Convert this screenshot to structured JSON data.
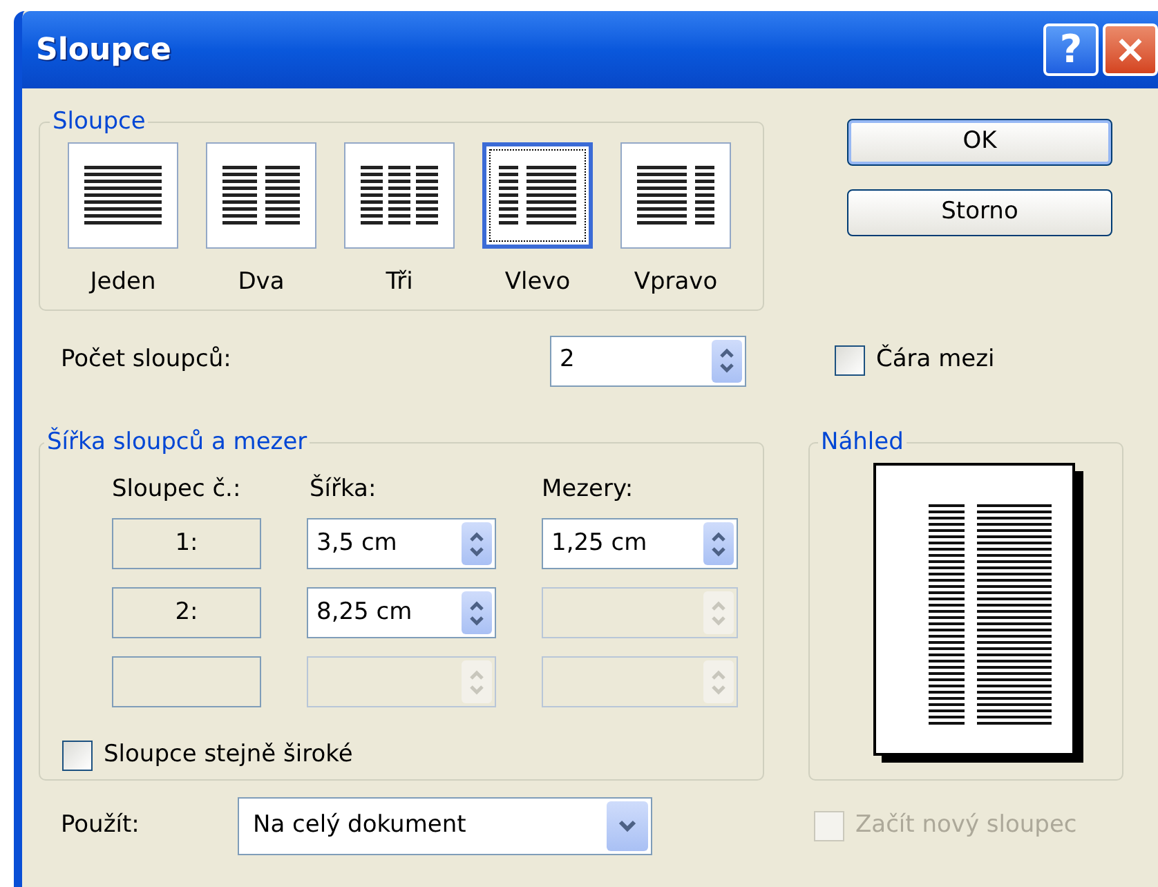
{
  "window": {
    "title": "Sloupce",
    "buttons": [
      {
        "kind": "help",
        "label": "?"
      },
      {
        "kind": "close",
        "label": "×"
      }
    ]
  },
  "presets": {
    "title": "Sloupce",
    "items": [
      {
        "label": "Jeden",
        "kind": "one",
        "selected": false
      },
      {
        "label": "Dva",
        "kind": "two",
        "selected": false
      },
      {
        "label": "Tři",
        "kind": "three",
        "selected": false
      },
      {
        "label": "Vlevo",
        "kind": "left",
        "selected": true
      },
      {
        "label": "Vpravo",
        "kind": "right",
        "selected": false
      }
    ]
  },
  "buttons": [
    {
      "label": "OK",
      "default": true
    },
    {
      "label": "Storno",
      "default": false
    }
  ],
  "column_count": {
    "label": "Počet sloupců:",
    "value": "2"
  },
  "line_between": {
    "label": "Čára mezi",
    "checked": false,
    "disabled": false
  },
  "widths": {
    "title": "Šířka sloupců a mezer",
    "headers": [
      "Sloupec č.:",
      "Šířka:",
      "Mezery:"
    ],
    "rows": [
      {
        "number": "1:",
        "width": {
          "value": "3,5 cm",
          "disabled": false
        },
        "spacing": {
          "value": "1,25 cm",
          "disabled": false
        }
      },
      {
        "number": "2:",
        "width": {
          "value": "8,25 cm",
          "disabled": false
        },
        "spacing": {
          "disabled": true
        }
      },
      {
        "width": {
          "disabled": true
        },
        "spacing": {
          "disabled": true
        }
      }
    ],
    "equal": {
      "label": "Sloupce stejně široké",
      "checked": false,
      "disabled": false
    }
  },
  "preview": {
    "title": "Náhled"
  },
  "apply": {
    "label": "Použít:",
    "value": "Na celý dokument"
  },
  "new_column": {
    "label": "Začít nový sloupec",
    "checked": false,
    "disabled": true
  }
}
